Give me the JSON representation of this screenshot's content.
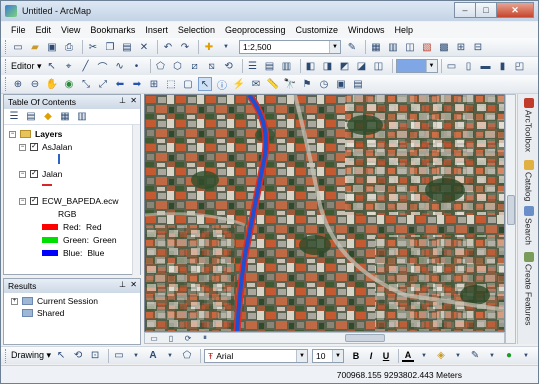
{
  "window": {
    "title": "Untitled - ArcMap",
    "min": "–",
    "max": "□",
    "close": "✕"
  },
  "menu": [
    "File",
    "Edit",
    "View",
    "Bookmarks",
    "Insert",
    "Selection",
    "Geoprocessing",
    "Customize",
    "Windows",
    "Help"
  ],
  "toolbar": {
    "scale": "1:2,500",
    "editor_label": "Editor ▾"
  },
  "toc": {
    "title": "Table Of Contents",
    "root": "Layers",
    "layers": [
      {
        "name": "AsJalan",
        "symbol": "blue-line"
      },
      {
        "name": "Jalan",
        "symbol": "red-line"
      },
      {
        "name": "ECW_BAPEDA.ecw",
        "sub": "RGB",
        "bands": [
          {
            "label": "Red:",
            "value": "Red",
            "color": "#ff0000"
          },
          {
            "label": "Green:",
            "value": "Green",
            "color": "#00e000"
          },
          {
            "label": "Blue:",
            "value": "Blue",
            "color": "#0000ff"
          }
        ]
      }
    ]
  },
  "results": {
    "title": "Results",
    "items": [
      "Current Session",
      "Shared"
    ]
  },
  "dock_tabs": [
    "ArcToolbox",
    "Catalog",
    "Search",
    "Create Features"
  ],
  "drawing": {
    "label": "Drawing ▾",
    "font": "Arial",
    "size": "10",
    "bold": "B",
    "italic": "I",
    "underline": "U",
    "font_color": "A"
  },
  "status": {
    "coords": "700968.155  9293802.443 Meters"
  },
  "colors": {
    "road_blue": "#1f4fd0",
    "road_red": "#d8302a",
    "roof": "#c8643c"
  }
}
